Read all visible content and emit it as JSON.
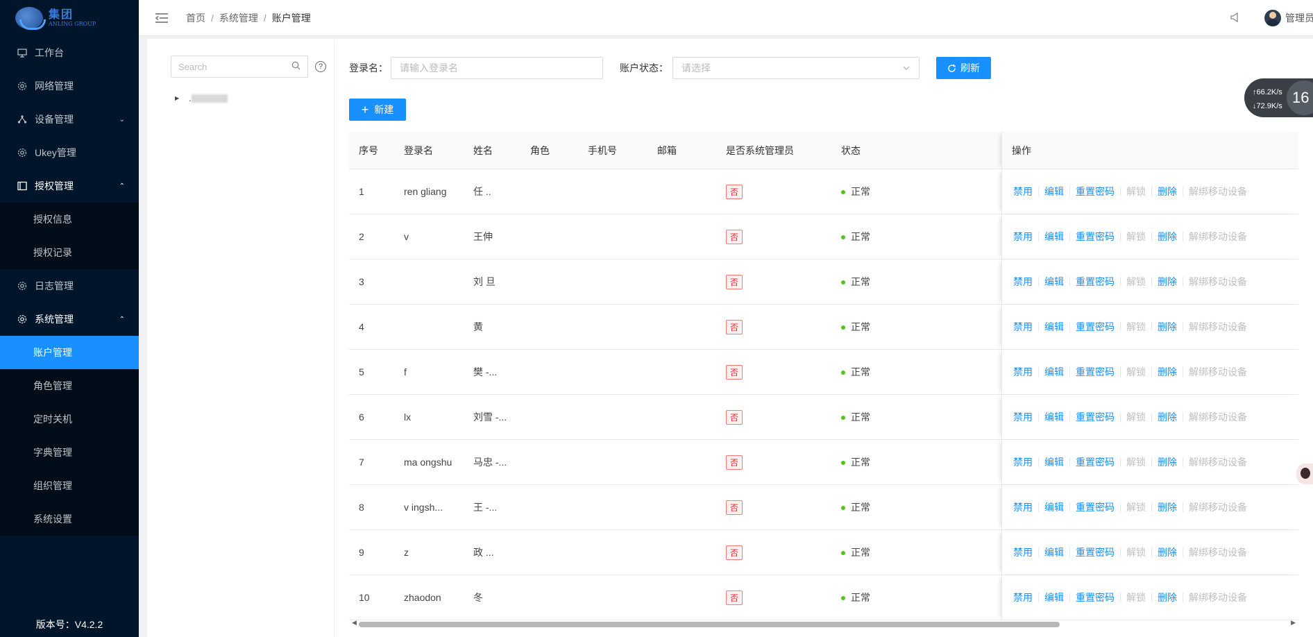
{
  "logo": {
    "name_cn": "集团",
    "name_en": "ANLING GROUP"
  },
  "sidebar": {
    "items": [
      {
        "label": "工作台",
        "icon": "desktop-icon"
      },
      {
        "label": "网络管理",
        "icon": "gear-icon"
      },
      {
        "label": "设备管理",
        "icon": "cluster-icon",
        "chevron": "⌄"
      },
      {
        "label": "Ukey管理",
        "icon": "gear-icon"
      },
      {
        "label": "授权管理",
        "icon": "table-icon",
        "chevron": "⌃",
        "children": [
          "授权信息",
          "授权记录"
        ]
      },
      {
        "label": "日志管理",
        "icon": "gear-icon"
      },
      {
        "label": "系统管理",
        "icon": "gear-icon",
        "chevron": "⌃",
        "children": [
          "账户管理",
          "角色管理",
          "定时关机",
          "字典管理",
          "组织管理",
          "系统设置"
        ]
      }
    ],
    "active_item": "账户管理",
    "version": "版本号：V4.2.2"
  },
  "header": {
    "breadcrumb": [
      "首页",
      "系统管理",
      "账户管理"
    ],
    "separator": "/",
    "user_name": "管理员"
  },
  "tree": {
    "search_placeholder": "Search",
    "help": "?",
    "node_label": "."
  },
  "filters": {
    "login_label": "登录名：",
    "login_placeholder": "请输入登录名",
    "status_label": "账户状态：",
    "status_placeholder": "请选择",
    "refresh": "刷新",
    "new": "新建"
  },
  "table": {
    "columns": [
      "序号",
      "登录名",
      "姓名",
      "角色",
      "手机号",
      "邮箱",
      "是否系统管理员",
      "状态",
      "操作"
    ],
    "rows": [
      {
        "no": "1",
        "login": "ren  gliang",
        "name": "任 ..",
        "admin": "否",
        "status": "正常"
      },
      {
        "no": "2",
        "login": "v",
        "name": "王伸",
        "admin": "否",
        "status": "正常"
      },
      {
        "no": "3",
        "login": "",
        "name": "刘 旦",
        "admin": "否",
        "status": "正常"
      },
      {
        "no": "4",
        "login": "",
        "name": "黄 ",
        "admin": "否",
        "status": "正常"
      },
      {
        "no": "5",
        "login": "f",
        "name": "樊  -...",
        "admin": "否",
        "status": "正常"
      },
      {
        "no": "6",
        "login": "lx",
        "name": "刘雪 -...",
        "admin": "否",
        "status": "正常"
      },
      {
        "no": "7",
        "login": "ma  ongshu",
        "name": "马忠 -...",
        "admin": "否",
        "status": "正常"
      },
      {
        "no": "8",
        "login": "v  ingsh...",
        "name": "王  -...",
        "admin": "否",
        "status": "正常"
      },
      {
        "no": "9",
        "login": "z",
        "name": "  政 ...",
        "admin": "否",
        "status": "正常"
      },
      {
        "no": "10",
        "login": "zhaodon",
        "name": " 冬",
        "admin": "否",
        "status": "正常"
      }
    ],
    "actions": [
      "禁用",
      "编辑",
      "重置密码",
      "解锁",
      "删除",
      "解绑移动设备"
    ],
    "disabled_actions": [
      "解锁",
      "解绑移动设备"
    ]
  },
  "float_widget": {
    "up": "↑66.2K/s",
    "down": "↓72.9K/s",
    "value": "16"
  },
  "colors": {
    "sidebar_bg": "#001529",
    "primary": "#1890ff",
    "danger": "#f5222d",
    "success": "#52c41a"
  }
}
